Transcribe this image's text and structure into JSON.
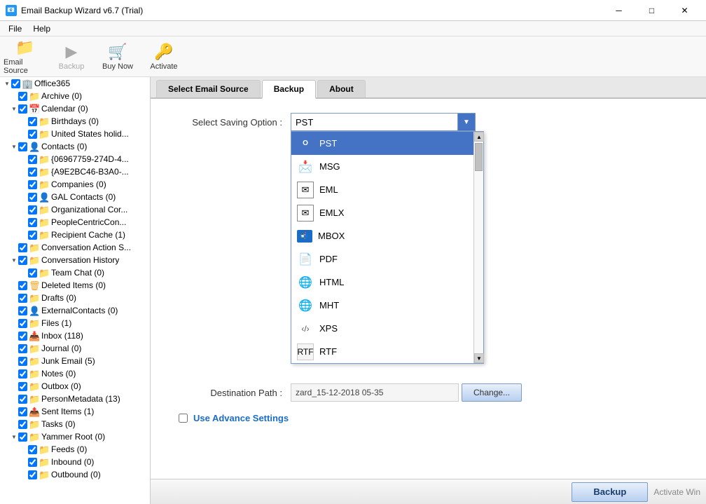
{
  "app": {
    "title": "Email Backup Wizard v6.7 (Trial)",
    "icon": "📧"
  },
  "titlebar": {
    "minimize": "─",
    "maximize": "□",
    "close": "✕"
  },
  "menubar": {
    "items": [
      {
        "label": "File"
      },
      {
        "label": "Help"
      }
    ]
  },
  "toolbar": {
    "buttons": [
      {
        "label": "Email Source",
        "icon": "📁",
        "name": "email-source",
        "disabled": false
      },
      {
        "label": "Backup",
        "icon": "▶",
        "name": "backup",
        "disabled": true
      },
      {
        "label": "Buy Now",
        "icon": "🛒",
        "name": "buy-now",
        "disabled": false
      },
      {
        "label": "Activate",
        "icon": "🔑",
        "name": "activate",
        "disabled": false
      }
    ]
  },
  "tree": {
    "root": "Office365",
    "items": [
      {
        "label": "Office365",
        "level": 1,
        "expanded": true,
        "checked": true,
        "hasExpander": true
      },
      {
        "label": "Archive (0)",
        "level": 2,
        "expanded": false,
        "checked": true,
        "hasExpander": false
      },
      {
        "label": "Calendar (0)",
        "level": 2,
        "expanded": true,
        "checked": true,
        "hasExpander": true
      },
      {
        "label": "Birthdays (0)",
        "level": 3,
        "expanded": false,
        "checked": true,
        "hasExpander": false
      },
      {
        "label": "United States holid...",
        "level": 3,
        "expanded": false,
        "checked": true,
        "hasExpander": false
      },
      {
        "label": "Contacts (0)",
        "level": 2,
        "expanded": true,
        "checked": true,
        "hasExpander": true
      },
      {
        "label": "{06967759-274D-4...",
        "level": 3,
        "expanded": false,
        "checked": true,
        "hasExpander": false
      },
      {
        "label": "{A9E2BC46-B3A0-...",
        "level": 3,
        "expanded": false,
        "checked": true,
        "hasExpander": false
      },
      {
        "label": "Companies (0)",
        "level": 3,
        "expanded": false,
        "checked": true,
        "hasExpander": false
      },
      {
        "label": "GAL Contacts (0)",
        "level": 3,
        "expanded": false,
        "checked": true,
        "hasExpander": false
      },
      {
        "label": "Organizational Cor...",
        "level": 3,
        "expanded": false,
        "checked": true,
        "hasExpander": false
      },
      {
        "label": "PeopleCentricCon...",
        "level": 3,
        "expanded": false,
        "checked": true,
        "hasExpander": false
      },
      {
        "label": "Recipient Cache (1)",
        "level": 3,
        "expanded": false,
        "checked": true,
        "hasExpander": false
      },
      {
        "label": "Conversation Action S...",
        "level": 2,
        "expanded": false,
        "checked": true,
        "hasExpander": false
      },
      {
        "label": "Conversation History",
        "level": 2,
        "expanded": true,
        "checked": true,
        "hasExpander": true
      },
      {
        "label": "Team Chat (0)",
        "level": 3,
        "expanded": false,
        "checked": true,
        "hasExpander": false
      },
      {
        "label": "Deleted Items (0)",
        "level": 2,
        "expanded": false,
        "checked": true,
        "hasExpander": false
      },
      {
        "label": "Drafts (0)",
        "level": 2,
        "expanded": false,
        "checked": true,
        "hasExpander": false
      },
      {
        "label": "ExternalContacts (0)",
        "level": 2,
        "expanded": false,
        "checked": true,
        "hasExpander": false
      },
      {
        "label": "Files (1)",
        "level": 2,
        "expanded": false,
        "checked": true,
        "hasExpander": false
      },
      {
        "label": "Inbox (118)",
        "level": 2,
        "expanded": false,
        "checked": true,
        "hasExpander": false
      },
      {
        "label": "Journal (0)",
        "level": 2,
        "expanded": false,
        "checked": true,
        "hasExpander": false
      },
      {
        "label": "Junk Email (5)",
        "level": 2,
        "expanded": false,
        "checked": true,
        "hasExpander": false
      },
      {
        "label": "Notes (0)",
        "level": 2,
        "expanded": false,
        "checked": true,
        "hasExpander": false
      },
      {
        "label": "Outbox (0)",
        "level": 2,
        "expanded": false,
        "checked": true,
        "hasExpander": false
      },
      {
        "label": "PersonMetadata (13)",
        "level": 2,
        "expanded": false,
        "checked": true,
        "hasExpander": false
      },
      {
        "label": "Sent Items (1)",
        "level": 2,
        "expanded": false,
        "checked": true,
        "hasExpander": false
      },
      {
        "label": "Tasks (0)",
        "level": 2,
        "expanded": false,
        "checked": true,
        "hasExpander": false
      },
      {
        "label": "Yammer Root (0)",
        "level": 2,
        "expanded": true,
        "checked": true,
        "hasExpander": true
      },
      {
        "label": "Feeds (0)",
        "level": 3,
        "expanded": false,
        "checked": true,
        "hasExpander": false
      },
      {
        "label": "Inbound (0)",
        "level": 3,
        "expanded": false,
        "checked": true,
        "hasExpander": false
      },
      {
        "label": "Outbound (0)",
        "level": 3,
        "expanded": false,
        "checked": true,
        "hasExpander": false
      }
    ]
  },
  "tabs": [
    {
      "label": "Select Email Source",
      "active": false,
      "name": "tab-select-email-source"
    },
    {
      "label": "Backup",
      "active": true,
      "name": "tab-backup"
    },
    {
      "label": "About",
      "active": false,
      "name": "tab-about"
    }
  ],
  "backup_tab": {
    "saving_option_label": "Select Saving Option :",
    "selected_format": "PST",
    "formats": [
      {
        "label": "PST",
        "icon": "📊",
        "color": "#4472C4"
      },
      {
        "label": "MSG",
        "icon": "📩",
        "color": "#f5a623"
      },
      {
        "label": "EML",
        "icon": "✉",
        "color": "#555"
      },
      {
        "label": "EMLX",
        "icon": "✉",
        "color": "#555"
      },
      {
        "label": "MBOX",
        "icon": "📬",
        "color": "#2196F3"
      },
      {
        "label": "PDF",
        "icon": "📄",
        "color": "#e74c3c"
      },
      {
        "label": "HTML",
        "icon": "🌐",
        "color": "#2196F3"
      },
      {
        "label": "MHT",
        "icon": "🌐",
        "color": "#2196F3"
      },
      {
        "label": "XPS",
        "icon": "📋",
        "color": "#555"
      },
      {
        "label": "RTF",
        "icon": "📝",
        "color": "#555"
      }
    ],
    "destination_label": "Destination Path :",
    "destination_path": "zard_15-12-2018 05-35",
    "change_button": "Change...",
    "advance_settings_label": "Use Advance Settings",
    "backup_button": "Backup",
    "activate_text": "Activate Win\nGo to Settings to"
  }
}
